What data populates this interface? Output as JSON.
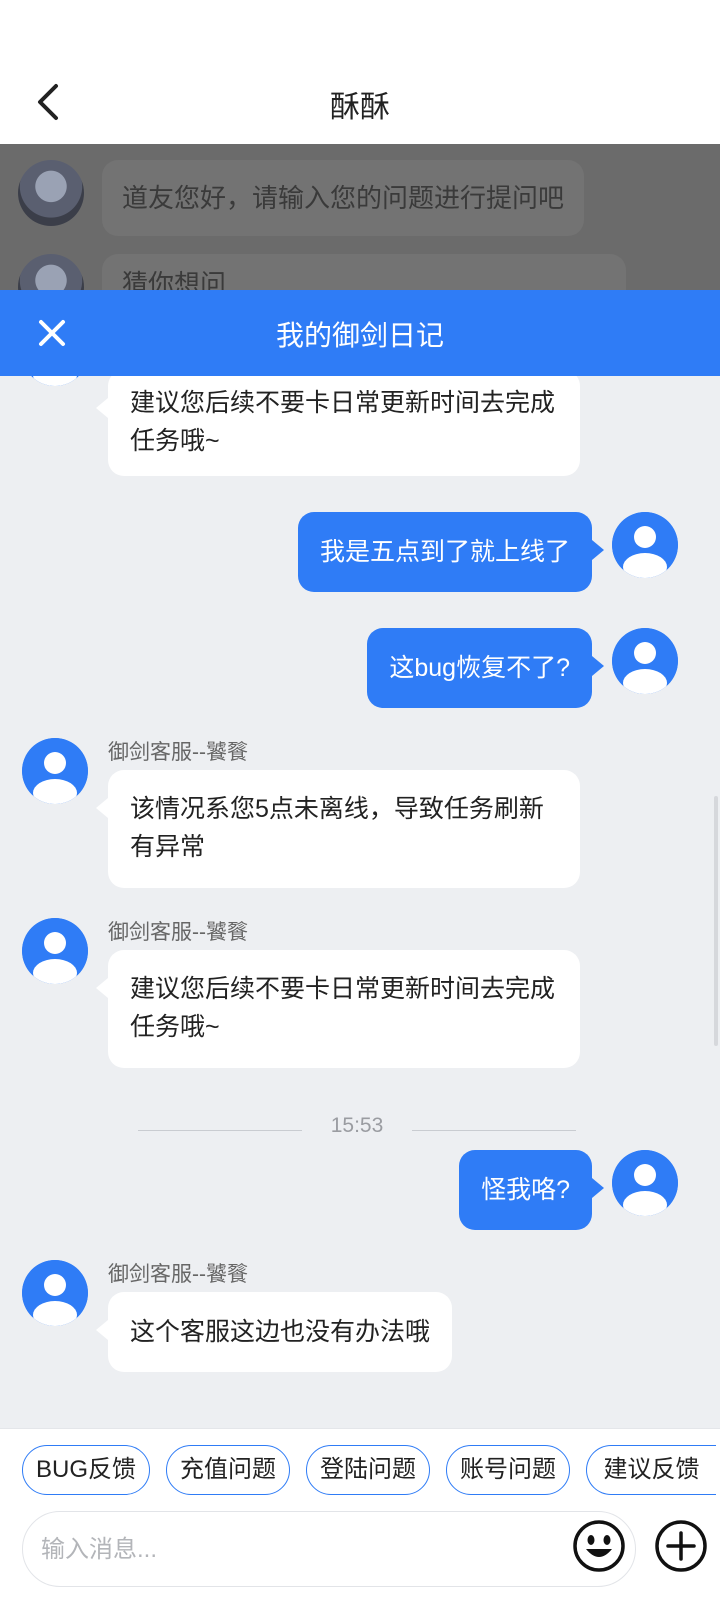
{
  "header": {
    "title": "酥酥"
  },
  "background_chat": {
    "greeting": "道友您好，请输入您的问题进行提问吧",
    "partial_message": "猜你想问"
  },
  "panel": {
    "title": "我的御剑日记"
  },
  "messages": {
    "m1": {
      "line1": "建议您后续不要卡日常更新时间去完成",
      "line2": "任务哦~"
    },
    "m2": {
      "text": "我是五点到了就上线了"
    },
    "m3": {
      "text": "这bug恢复不了?"
    },
    "m4": {
      "sender": "御剑客服--饕餮",
      "line1": "该情况系您5点未离线，导致任务刷新",
      "line2": "有异常"
    },
    "m5": {
      "sender": "御剑客服--饕餮",
      "line1": "建议您后续不要卡日常更新时间去完成",
      "line2": "任务哦~"
    },
    "time": "15:53",
    "m6": {
      "text": "怪我咯?"
    },
    "m7": {
      "sender": "御剑客服--饕餮",
      "text": "这个客服这边也没有办法哦"
    }
  },
  "quick_replies": [
    "BUG反馈",
    "充值问题",
    "登陆问题",
    "账号问题",
    "建议反馈"
  ],
  "input": {
    "placeholder": "输入消息..."
  },
  "colors": {
    "accent": "#2f7cf6",
    "chat_bg": "#edeff2"
  }
}
